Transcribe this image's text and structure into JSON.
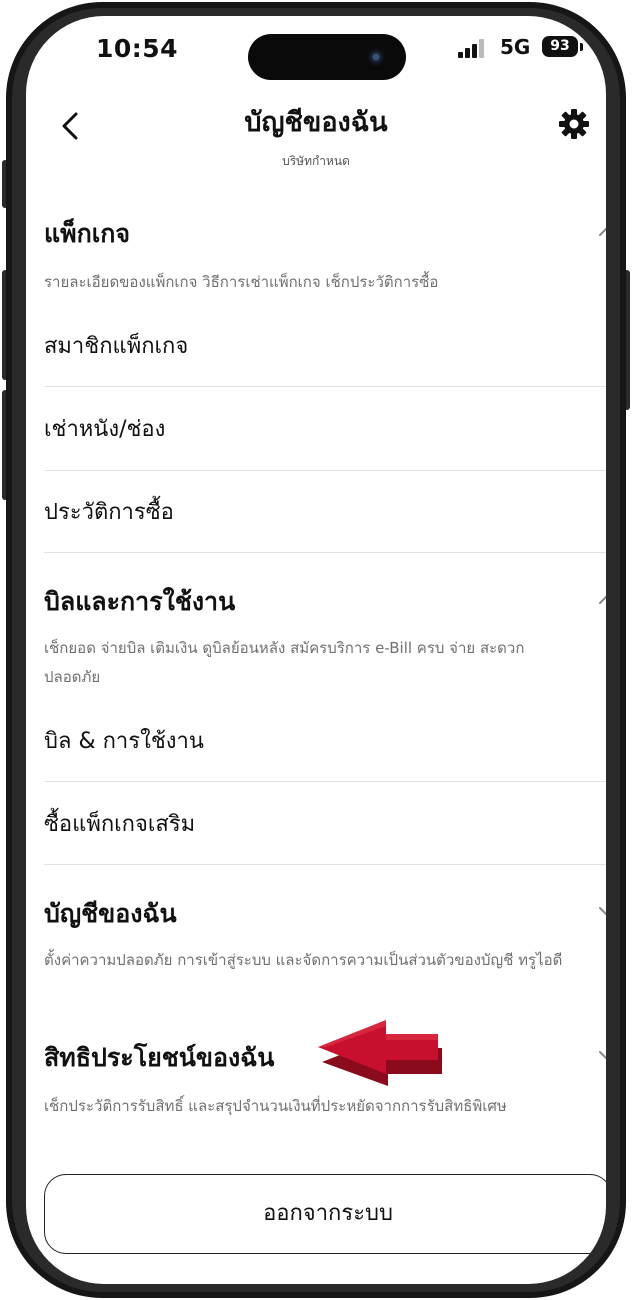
{
  "status_bar": {
    "time": "10:54",
    "network": "5G",
    "battery": "93"
  },
  "header": {
    "title": "บัญชีของฉัน",
    "subtitle": "บริษัทกำหนด"
  },
  "sections": [
    {
      "title": "แพ็กเกจ",
      "description": "รายละเอียดของแพ็กเกจ วิธีการเช่าแพ็กเกจ เช็กประวัติการซื้อ",
      "expanded": true,
      "items": [
        {
          "label": "สมาชิกแพ็กเกจ"
        },
        {
          "label": "เช่าหนัง/ช่อง"
        },
        {
          "label": "ประวัติการซื้อ"
        }
      ]
    },
    {
      "title": "บิลและการใช้งาน",
      "description": "เช็กยอด จ่ายบิล เติมเงิน ดูบิลย้อนหลัง สมัครบริการ e-Bill ครบ จ่าย สะดวก ปลอดภัย",
      "expanded": true,
      "items": [
        {
          "label": "บิล & การใช้งาน"
        },
        {
          "label": "ซื้อแพ็กเกจเสริม"
        }
      ]
    },
    {
      "title": "บัญชีของฉัน",
      "description": "ตั้งค่าความปลอดภัย การเข้าสู่ระบบ และจัดการความเป็นส่วนตัวของบัญชี ทรูไอดี",
      "expanded": false
    },
    {
      "title": "สิทธิประโยชน์ของฉัน",
      "description": "เช็กประวัติการรับสิทธิ์ และสรุปจำนวนเงินที่ประหยัดจากการรับสิทธิพิเศษ",
      "expanded": false
    }
  ],
  "logout_label": "ออกจากระบบ",
  "icons": {
    "back": "chevron-left-icon",
    "settings": "gear-icon",
    "collapse": "chevron-up-icon",
    "expand": "chevron-down-icon",
    "row": "chevron-right-icon",
    "annotation": "red-arrow-annotation"
  },
  "colors": {
    "annotation_arrow": "#c8102e"
  }
}
